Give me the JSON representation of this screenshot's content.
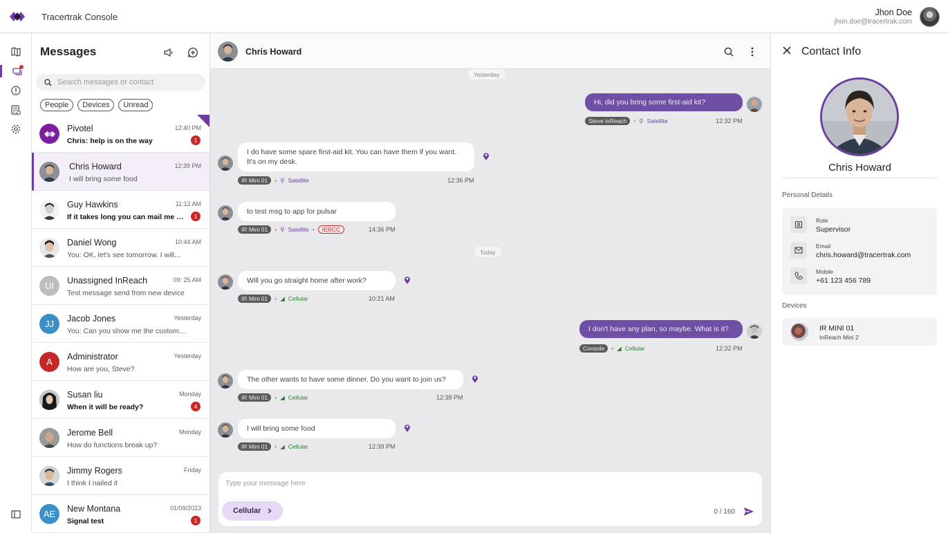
{
  "app": {
    "title": "Tracertrak Console"
  },
  "user": {
    "name": "Jhon Doe",
    "email": "jhon.doe@tracertrak.com"
  },
  "messages": {
    "title": "Messages",
    "search_placeholder": "Search messages or contact",
    "filters": [
      "People",
      "Devices",
      "Unread"
    ],
    "conversations": [
      {
        "name": "Pivotel",
        "time": "12:40 PM",
        "preview": "Chris: help is on the way",
        "unread": 1,
        "bold": true,
        "avatar_color": "#7b1fa2",
        "initials": ""
      },
      {
        "name": "Chris Howard",
        "time": "12:39 PM",
        "preview": "I will bring some food",
        "unread": 0,
        "bold": false,
        "avatar_color": "#4a4a4a",
        "initials": ""
      },
      {
        "name": "Guy Hawkins",
        "time": "11:12 AM",
        "preview": "If it takes long you can mail me wi...",
        "unread": 1,
        "bold": true,
        "avatar_color": "#5a5a5a",
        "initials": ""
      },
      {
        "name": "Daniel Wong",
        "time": "10:44 AM",
        "preview": "You: OK, let's see tomorrow. I will...",
        "unread": 0,
        "bold": false,
        "avatar_color": "#6b6b6b",
        "initials": ""
      },
      {
        "name": "Unassigned InReach",
        "time": "09: 25 AM",
        "preview": "Test message send from new device",
        "unread": 0,
        "bold": false,
        "avatar_color": "#bdbdbd",
        "initials": "UI"
      },
      {
        "name": "Jacob Jones",
        "time": "Yesterday",
        "preview": "You: Can you show me the custom...",
        "unread": 0,
        "bold": false,
        "avatar_color": "#3a8fc8",
        "initials": "JJ"
      },
      {
        "name": "Administrator",
        "time": "Yesterday",
        "preview": "How are you, Steve?",
        "unread": 0,
        "bold": false,
        "avatar_color": "#c62828",
        "initials": "A"
      },
      {
        "name": "Susan liu",
        "time": "Monday",
        "preview": "When it will be ready?",
        "unread": 4,
        "bold": true,
        "avatar_color": "#3a3a3a",
        "initials": ""
      },
      {
        "name": "Jerome Bell",
        "time": "Monday",
        "preview": "How do functions break up?",
        "unread": 0,
        "bold": false,
        "avatar_color": "#7a7a7a",
        "initials": ""
      },
      {
        "name": "Jimmy Rogers",
        "time": "Friday",
        "preview": "I think I nailed it",
        "unread": 0,
        "bold": false,
        "avatar_color": "#8a8a8a",
        "initials": ""
      },
      {
        "name": "New Montana",
        "time": "01/09/2023",
        "preview": "Signal test",
        "unread": 1,
        "bold": true,
        "avatar_color": "#3a8fc8",
        "initials": "AE"
      }
    ]
  },
  "chat": {
    "contact_name": "Chris Howard",
    "separators": {
      "yesterday": "Yesterday",
      "today": "Today"
    },
    "messages": [
      {
        "dir": "out",
        "text": "Hi, did you bring some first-aid kit?",
        "device": "Steve inReach",
        "channel": "Satellite",
        "time": "12:32 PM"
      },
      {
        "dir": "in",
        "text": "I do have some spare first-aid kit. You can have them if you want. It's on my desk.",
        "device": "IR Mini 01",
        "channel": "Satellite",
        "time": "12:36 PM"
      },
      {
        "dir": "in",
        "text": "to test msg to app for pulsar",
        "device": "IR Mini 01",
        "channel": "Satellite",
        "tag": "IERCC",
        "time": "14:36 PM"
      },
      {
        "dir": "in",
        "text": "Will you go straight home after work?",
        "device": "IR Mini 01",
        "channel": "Cellular",
        "time": "10:21 AM"
      },
      {
        "dir": "out",
        "text": "I don't have any plan, so maybe. What is it?",
        "device": "Console",
        "channel": "Cellular",
        "time": "12:32 PM"
      },
      {
        "dir": "in",
        "text": "The other wants to have some dinner. Do you want to join us?",
        "device": "IR Mini 01",
        "channel": "Cellular",
        "time": "12:38 PM"
      },
      {
        "dir": "in",
        "text": "I will bring some food",
        "device": "IR Mini 01",
        "channel": "Cellular",
        "time": "12:39 PM"
      }
    ],
    "composer": {
      "placeholder": "Type your message here",
      "channel_button": "Cellular",
      "counter": "0 / 160"
    }
  },
  "contact_info": {
    "title": "Contact Info",
    "name": "Chris Howard",
    "personal_details_label": "Personal Details",
    "details": [
      {
        "label": "Role",
        "value": "Supervisor",
        "icon": "badge-icon"
      },
      {
        "label": "Email",
        "value": "chris.howard@tracertrak.com",
        "icon": "mail-icon"
      },
      {
        "label": "Mobile",
        "value": "+61 123 456 789",
        "icon": "phone-icon"
      }
    ],
    "devices_label": "Devices",
    "device": {
      "name": "IR MINI 01",
      "model": "InReach Mini 2"
    }
  },
  "colors": {
    "accent": "#6b3fa0",
    "badge": "#c62828",
    "cellular": "#2e7d32"
  }
}
